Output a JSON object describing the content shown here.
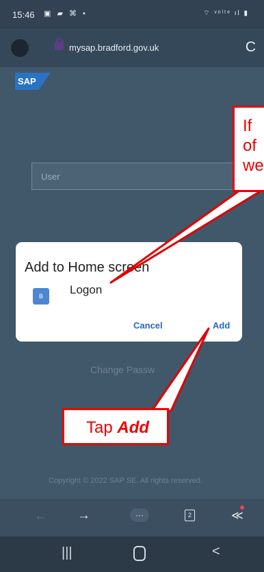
{
  "status_bar": {
    "time": "15:46",
    "left_icons": "▣ ▰ ⌘ •",
    "right_icons": "⌔ ᵛᵒˡᵗᵉ ıl ▮"
  },
  "browser": {
    "url": "mysap.bradford.gov.uk",
    "reload_icon": "C"
  },
  "page": {
    "logo": "SAP",
    "user_placeholder": "User",
    "change_password": "Change Passw",
    "copyright": "Copyright © 2022 SAP SE. All rights reserved."
  },
  "dialog": {
    "title": "Add to Home screen",
    "app_icon_letter": "B",
    "app_name": "Logon",
    "cancel_label": "Cancel",
    "add_label": "Add"
  },
  "toolbar": {
    "back": "←",
    "forward": "→",
    "more": "···",
    "tab_count": "2",
    "share": "≪"
  },
  "home_bar": {
    "recent": "|||",
    "back": "<"
  },
  "annotations": {
    "top_callout_lines": [
      "If",
      "of",
      "we"
    ],
    "tap_prefix": "Tap ",
    "tap_emphasis": "Add",
    "color": "#e00000"
  }
}
